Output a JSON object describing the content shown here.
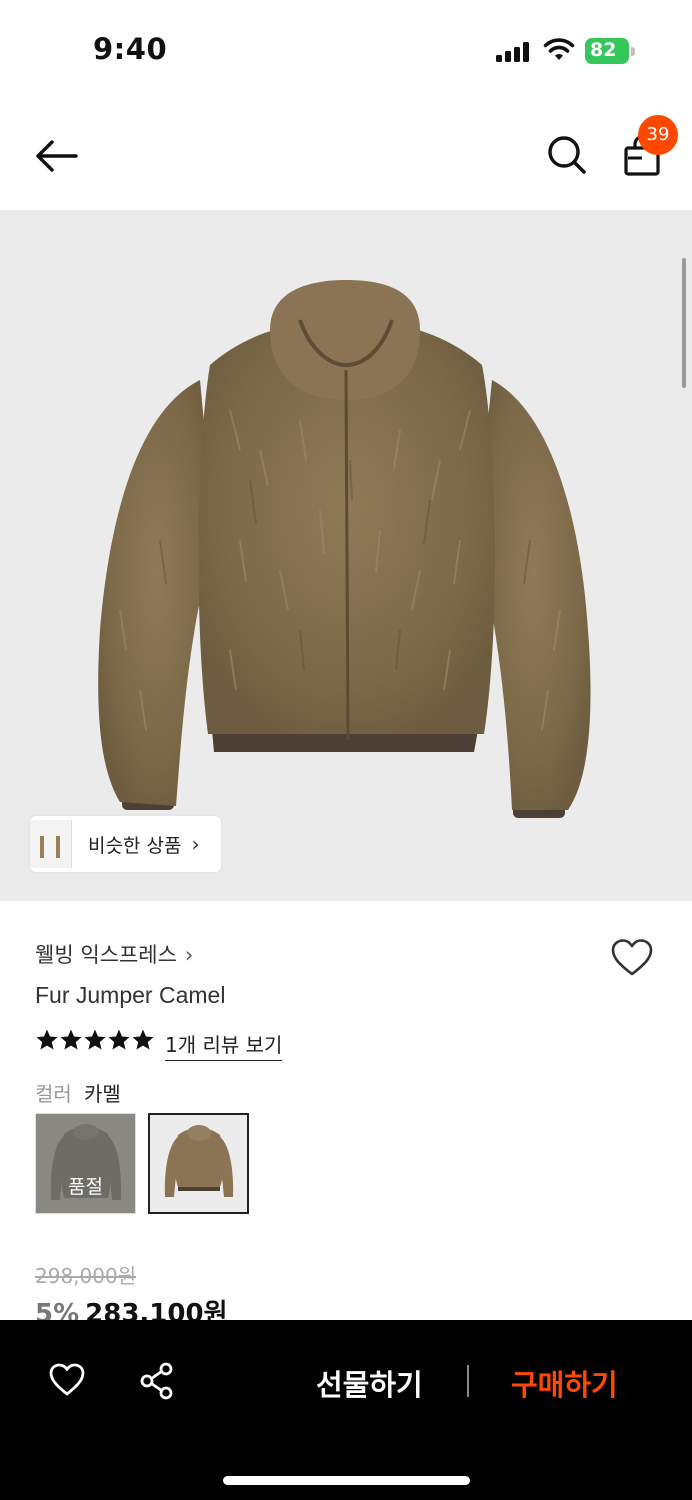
{
  "status_bar": {
    "time": "9:40",
    "battery": "82"
  },
  "header": {
    "cart_count": "39",
    "back_icon": "arrow-left-icon",
    "search_icon": "search-icon",
    "cart_icon": "shopping-bag-icon"
  },
  "hero": {
    "similar_label": "비슷한 상품",
    "similar_chevron": "›"
  },
  "product": {
    "brand": "웰빙 익스프레스",
    "brand_arrow": "›",
    "name": "Fur Jumper Camel",
    "rating": 5,
    "reviews_link": "1개 리뷰 보기",
    "color_label": "컬러",
    "color_value": "카멜",
    "swatches": [
      {
        "state": "품절"
      },
      {
        "state": "selected"
      }
    ],
    "original_price": "298,000원",
    "discount": "5%",
    "final_price": "283,100원"
  },
  "bottom_bar": {
    "gift_label": "선물하기",
    "buy_label": "구매하기",
    "accent": "#ff4800"
  }
}
